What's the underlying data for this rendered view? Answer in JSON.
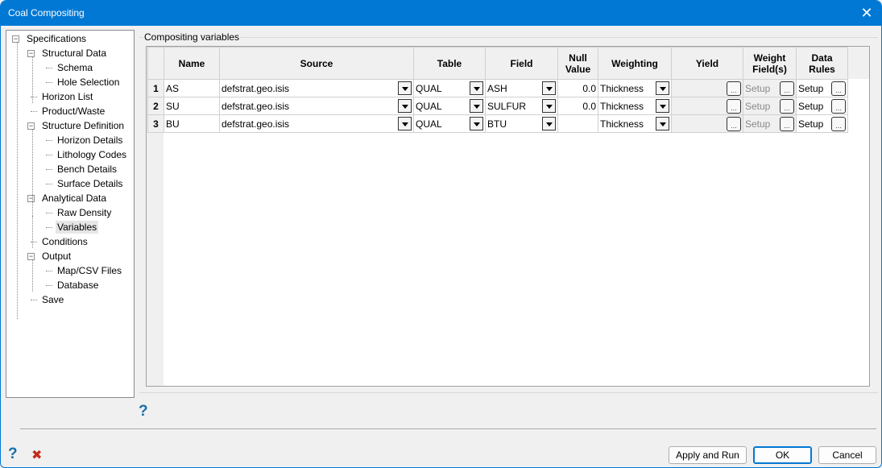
{
  "window": {
    "title": "Coal Compositing"
  },
  "tree": {
    "items": [
      {
        "label": "Specifications",
        "expandable": true
      },
      {
        "label": "Structural Data",
        "expandable": true
      },
      {
        "label": "Schema"
      },
      {
        "label": "Hole Selection"
      },
      {
        "label": "Horizon List"
      },
      {
        "label": "Product/Waste"
      },
      {
        "label": "Structure Definition",
        "expandable": true
      },
      {
        "label": "Horizon Details"
      },
      {
        "label": "Lithology Codes"
      },
      {
        "label": "Bench Details"
      },
      {
        "label": "Surface Details"
      },
      {
        "label": "Analytical Data",
        "expandable": true
      },
      {
        "label": "Raw Density"
      },
      {
        "label": "Variables",
        "selected": true
      },
      {
        "label": "Conditions"
      },
      {
        "label": "Output",
        "expandable": true
      },
      {
        "label": "Map/CSV Files"
      },
      {
        "label": "Database"
      },
      {
        "label": "Save"
      }
    ]
  },
  "group": {
    "label": "Compositing variables"
  },
  "grid": {
    "headers": [
      "Name",
      "Source",
      "Table",
      "Field",
      "Null Value",
      "Weighting",
      "Yield",
      "Weight Field(s)",
      "Data Rules"
    ],
    "rows": [
      {
        "num": "1",
        "name": "AS",
        "source": "defstrat.geo.isis",
        "table": "QUAL",
        "field": "ASH",
        "null": "0.0",
        "weighting": "Thickness",
        "yield": "",
        "weight": "Setup",
        "rules": "Setup"
      },
      {
        "num": "2",
        "name": "SU",
        "source": "defstrat.geo.isis",
        "table": "QUAL",
        "field": "SULFUR",
        "null": "0.0",
        "weighting": "Thickness",
        "yield": "",
        "weight": "Setup",
        "rules": "Setup"
      },
      {
        "num": "3",
        "name": "BU",
        "source": "defstrat.geo.isis",
        "table": "QUAL",
        "field": "BTU",
        "null": "",
        "weighting": "Thickness",
        "yield": "",
        "weight": "Setup",
        "rules": "Setup"
      }
    ],
    "ellipsis": "..."
  },
  "footer": {
    "help": "?",
    "close_icon": "✖",
    "apply_run": "Apply and Run",
    "ok": "OK",
    "cancel": "Cancel",
    "title_close": "✕"
  }
}
